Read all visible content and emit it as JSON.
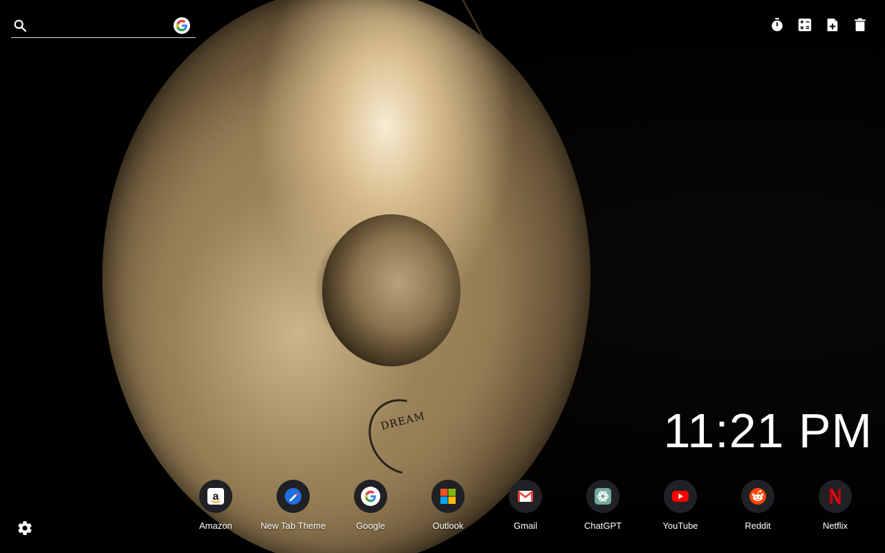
{
  "search": {
    "value": "",
    "placeholder": "",
    "engine_icon": "google-icon"
  },
  "toolbar": {
    "items": [
      {
        "icon": "timer-icon"
      },
      {
        "icon": "calculator-icon"
      },
      {
        "icon": "add-note-icon"
      },
      {
        "icon": "trash-icon"
      }
    ]
  },
  "wallpaper": {
    "logo_text": "DREAM"
  },
  "clock": {
    "time": "11:21 PM"
  },
  "shortcuts": [
    {
      "label": "Amazon",
      "icon": "amazon-icon"
    },
    {
      "label": "New Tab Theme",
      "icon": "new-tab-theme-icon"
    },
    {
      "label": "Google",
      "icon": "google-icon"
    },
    {
      "label": "Outlook",
      "icon": "microsoft-icon"
    },
    {
      "label": "Gmail",
      "icon": "gmail-icon"
    },
    {
      "label": "ChatGPT",
      "icon": "chatgpt-icon"
    },
    {
      "label": "YouTube",
      "icon": "youtube-icon"
    },
    {
      "label": "Reddit",
      "icon": "reddit-icon"
    },
    {
      "label": "Netflix",
      "icon": "netflix-icon"
    }
  ],
  "settings": {
    "icon": "gear-icon"
  },
  "colors": {
    "shortcut_bg": "#202124",
    "youtube_red": "#ff0000",
    "reddit_orange": "#ff4500",
    "netflix_red": "#e50914"
  }
}
